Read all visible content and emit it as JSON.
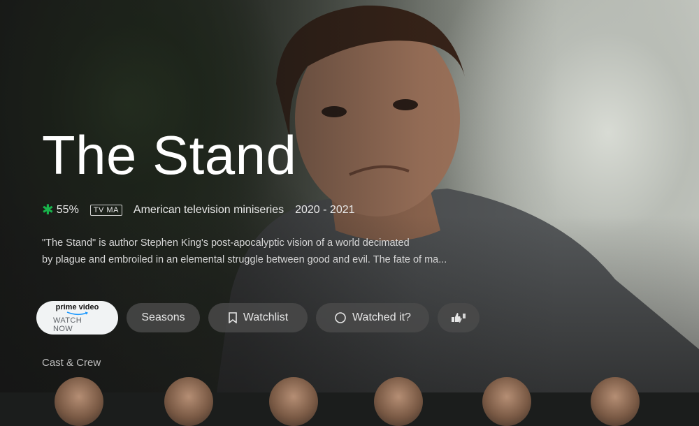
{
  "show": {
    "title": "The Stand",
    "score": "55%",
    "content_rating": "TV MA",
    "genre": "American television miniseries",
    "years": "2020 - 2021",
    "description_lines": [
      "\"The Stand\" is author Stephen King's post-apocalyptic vision of a world decimated",
      "by plague and embroiled in an elemental struggle between good and evil. The fate of ma..."
    ]
  },
  "actions": {
    "provider_logo": "prime video",
    "provider_action": "WATCH NOW",
    "seasons": "Seasons",
    "watchlist": "Watchlist",
    "watched": "Watched it?"
  },
  "cast": {
    "label": "Cast & Crew"
  },
  "colors": {
    "score_icon": "#18b34b",
    "primary_button_bg": "#f1f3f4",
    "chip_bg": "#4b4b4b"
  },
  "icons": {
    "score": "clover-icon",
    "watchlist": "bookmark-icon",
    "watched": "circle-icon",
    "rate": "thumbs-icon"
  }
}
